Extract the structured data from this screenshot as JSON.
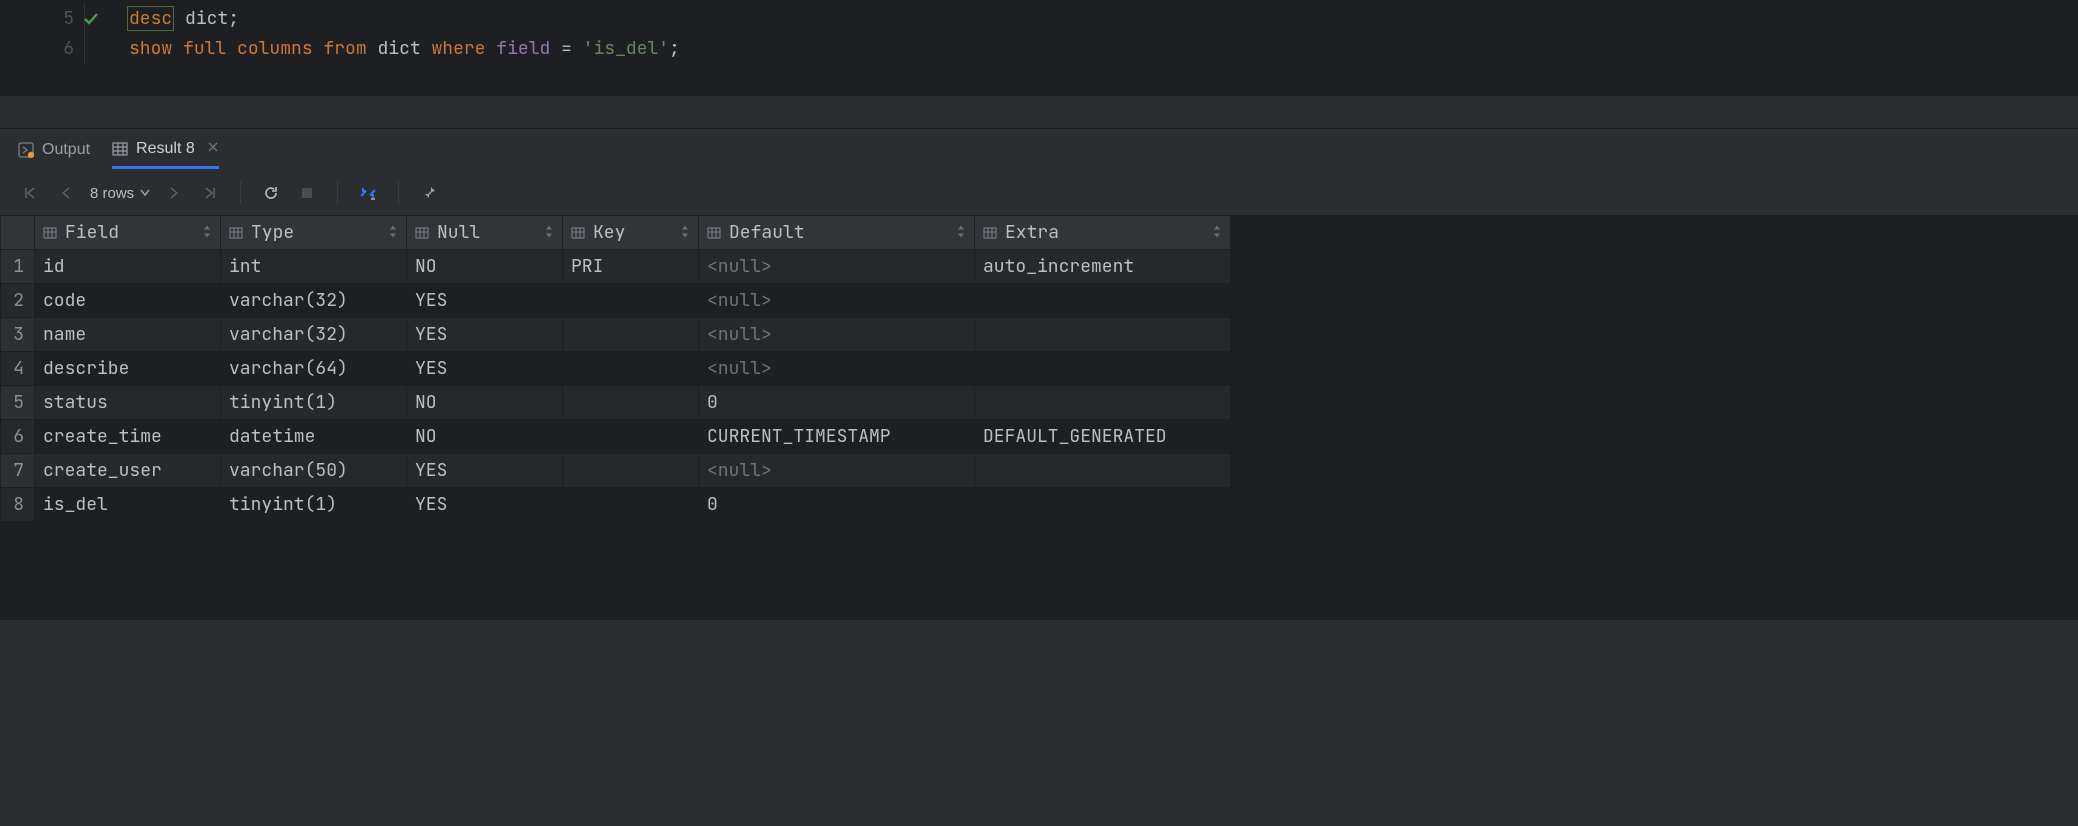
{
  "editor": {
    "lines": [
      {
        "num": "5",
        "active": true,
        "tokens": [
          {
            "t": "desc",
            "c": "kw1",
            "boxed": true
          },
          {
            "t": " ",
            "c": "punct"
          },
          {
            "t": "dict",
            "c": "ident"
          },
          {
            "t": ";",
            "c": "punct"
          }
        ]
      },
      {
        "num": "6",
        "active": false,
        "tokens": [
          {
            "t": "show",
            "c": "kw1"
          },
          {
            "t": " ",
            "c": "punct"
          },
          {
            "t": "full",
            "c": "kw1"
          },
          {
            "t": " ",
            "c": "punct"
          },
          {
            "t": "columns",
            "c": "kw1"
          },
          {
            "t": " ",
            "c": "punct"
          },
          {
            "t": "from",
            "c": "kw1"
          },
          {
            "t": " ",
            "c": "punct"
          },
          {
            "t": "dict",
            "c": "ident"
          },
          {
            "t": " ",
            "c": "punct"
          },
          {
            "t": "where",
            "c": "kw1"
          },
          {
            "t": " ",
            "c": "punct"
          },
          {
            "t": "field",
            "c": "fld"
          },
          {
            "t": " = ",
            "c": "punct"
          },
          {
            "t": "'is_del'",
            "c": "str"
          },
          {
            "t": ";",
            "c": "punct"
          }
        ]
      }
    ]
  },
  "tabs": {
    "output_label": "Output",
    "result_label": "Result 8"
  },
  "toolbar": {
    "rows_label": "8 rows"
  },
  "grid": {
    "columns": [
      "Field",
      "Type",
      "Null",
      "Key",
      "Default",
      "Extra"
    ],
    "rows": [
      {
        "Field": "id",
        "Type": "int",
        "Null": "NO",
        "Key": "PRI",
        "Default": null,
        "Extra": "auto_increment"
      },
      {
        "Field": "code",
        "Type": "varchar(32)",
        "Null": "YES",
        "Key": "",
        "Default": null,
        "Extra": ""
      },
      {
        "Field": "name",
        "Type": "varchar(32)",
        "Null": "YES",
        "Key": "",
        "Default": null,
        "Extra": ""
      },
      {
        "Field": "describe",
        "Type": "varchar(64)",
        "Null": "YES",
        "Key": "",
        "Default": null,
        "Extra": ""
      },
      {
        "Field": "status",
        "Type": "tinyint(1)",
        "Null": "NO",
        "Key": "",
        "Default": "0",
        "Extra": ""
      },
      {
        "Field": "create_time",
        "Type": "datetime",
        "Null": "NO",
        "Key": "",
        "Default": "CURRENT_TIMESTAMP",
        "Extra": "DEFAULT_GENERATED"
      },
      {
        "Field": "create_user",
        "Type": "varchar(50)",
        "Null": "YES",
        "Key": "",
        "Default": null,
        "Extra": ""
      },
      {
        "Field": "is_del",
        "Type": "tinyint(1)",
        "Null": "YES",
        "Key": "",
        "Default": "0",
        "Extra": ""
      }
    ],
    "null_text": "<null>"
  }
}
